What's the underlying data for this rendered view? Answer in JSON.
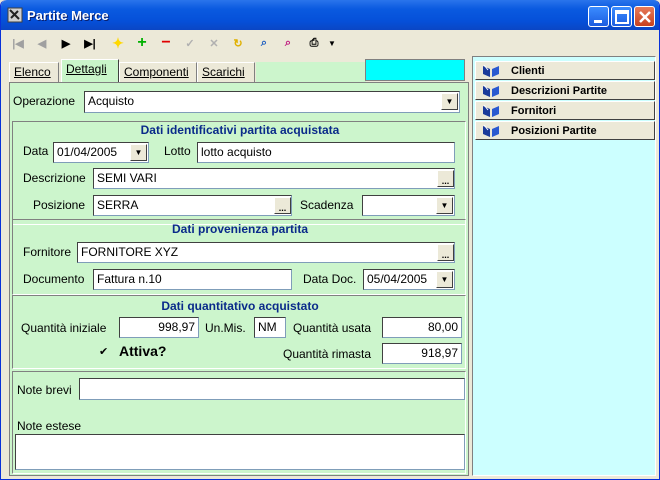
{
  "window": {
    "title": "Partite Merce"
  },
  "tabs": [
    "Elenco",
    "Dettagli",
    "Componenti",
    "Scarichi"
  ],
  "operazione": {
    "label": "Operazione",
    "value": "Acquisto"
  },
  "identificativi": {
    "title": "Dati identificativi partita acquistata",
    "data_label": "Data",
    "data_value": "01/04/2005",
    "lotto_label": "Lotto",
    "lotto_value": "lotto acquisto",
    "descrizione_label": "Descrizione",
    "descrizione_value": "SEMI VARI",
    "posizione_label": "Posizione",
    "posizione_value": "SERRA",
    "scadenza_label": "Scadenza",
    "scadenza_value": ""
  },
  "provenienza": {
    "title": "Dati provenienza partita",
    "fornitore_label": "Fornitore",
    "fornitore_value": "FORNITORE XYZ",
    "documento_label": "Documento",
    "documento_value": "Fattura n.10",
    "datadoc_label": "Data Doc.",
    "datadoc_value": "05/04/2005"
  },
  "quantitativo": {
    "title": "Dati quantitativo acquistato",
    "iniziale_label": "Quantità iniziale",
    "iniziale_value": "998,97",
    "unmis_label": "Un.Mis.",
    "unmis_value": "NM",
    "usata_label": "Quantità usata",
    "usata_value": "80,00",
    "attiva_check": "✔",
    "attiva_label": "Attiva?",
    "rimasta_label": "Quantità rimasta",
    "rimasta_value": "918,97"
  },
  "note": {
    "brevi_label": "Note brevi",
    "brevi_value": "",
    "estese_label": "Note estese",
    "estese_value": ""
  },
  "side_panel": [
    "Clienti",
    "Descrizioni Partite",
    "Fornitori",
    "Posizioni Partite"
  ],
  "colors": {
    "panel": "#ccf5cc",
    "side": "#ccffff",
    "accent": "#00ffff",
    "section_title": "#0a2a8a"
  }
}
